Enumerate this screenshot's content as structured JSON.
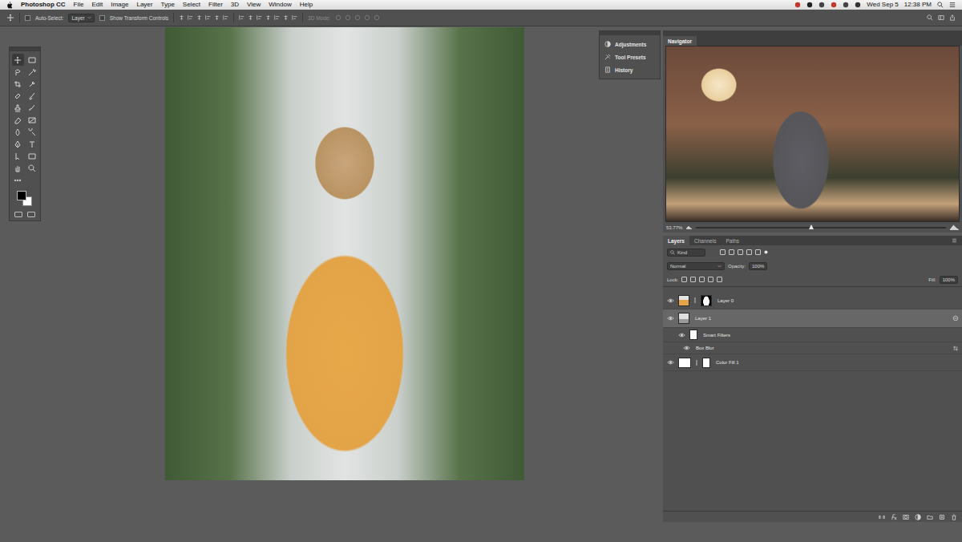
{
  "menu_bar": {
    "app": "Photoshop CC",
    "items": [
      "File",
      "Edit",
      "Image",
      "Layer",
      "Type",
      "Select",
      "Filter",
      "3D",
      "View",
      "Window",
      "Help"
    ],
    "date": "Wed Sep 5",
    "time": "12:38 PM"
  },
  "options_bar": {
    "auto_select_label": "Auto-Select:",
    "auto_select_checked": false,
    "auto_select_value": "Layer",
    "transform_label": "Show Transform Controls",
    "transform_checked": false,
    "mode_label": "3D Mode:"
  },
  "mini_panel": {
    "items": [
      "Adjustments",
      "Tool Presets",
      "History"
    ]
  },
  "navigator": {
    "tab": "Navigator",
    "zoom": "53.77%",
    "level": 0.46
  },
  "layers_panel": {
    "tabs": [
      {
        "label": "Layers",
        "selected": true
      },
      {
        "label": "Channels",
        "selected": false
      },
      {
        "label": "Paths",
        "selected": false
      }
    ],
    "filter": "Kind",
    "blend_mode": "Normal",
    "opacity_label": "Opacity:",
    "opacity": "100%",
    "lock_label": "Lock:",
    "fill_label": "Fill:",
    "fill": "100%",
    "layers": [
      {
        "name": "Layer 0",
        "kind": "layer",
        "visible": true,
        "selected": false
      },
      {
        "name": "Layer 1",
        "kind": "smart-object",
        "visible": true,
        "selected": true
      },
      {
        "name": "Smart Filters",
        "kind": "smart-filters",
        "visible": true,
        "selected": false
      },
      {
        "name": "Box Blur",
        "kind": "filter",
        "visible": true,
        "selected": false
      },
      {
        "name": "Color Fill 1",
        "kind": "fill",
        "visible": true,
        "selected": false
      }
    ]
  }
}
